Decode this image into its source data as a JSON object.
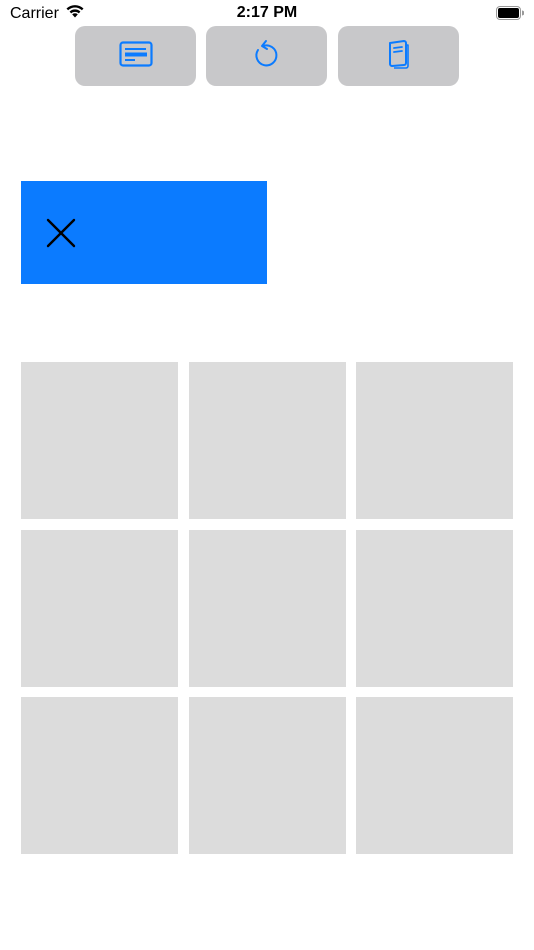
{
  "status_bar": {
    "carrier": "Carrier",
    "time": "2:17 PM",
    "icons": [
      "wifi-icon",
      "battery-icon"
    ]
  },
  "toolbar": {
    "buttons": [
      {
        "icon": "card-icon"
      },
      {
        "icon": "undo-icon"
      },
      {
        "icon": "book-icon"
      }
    ],
    "accent_color": "#0b7bff",
    "button_bg": "#c8c8ca"
  },
  "turn_indicator": {
    "current_player": "X",
    "icon": "x-mark-icon",
    "color": "#0b7bff"
  },
  "board": {
    "rows": 3,
    "cols": 3,
    "cells": [
      "",
      "",
      "",
      "",
      "",
      "",
      "",
      "",
      ""
    ],
    "cell_color": "#dcdcdc"
  }
}
